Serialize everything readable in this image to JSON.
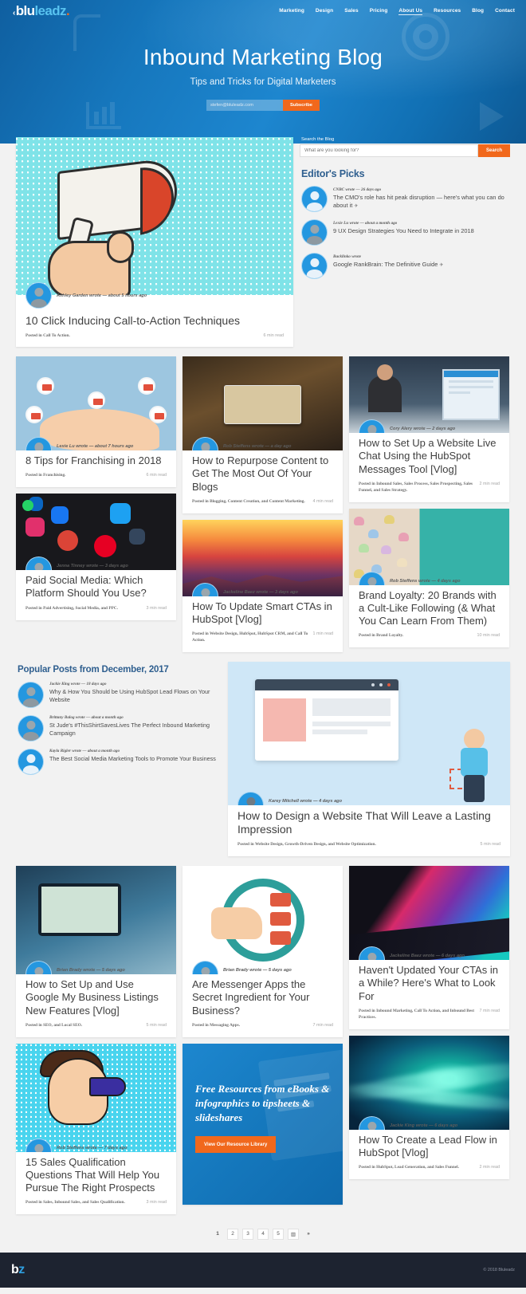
{
  "brand": {
    "mark": "‹",
    "name_a": "blu",
    "name_b": "leadz",
    "dot": "."
  },
  "nav": {
    "items": [
      "Marketing",
      "Design",
      "Sales",
      "Pricing",
      "About Us",
      "Resources",
      "Blog",
      "Contact"
    ]
  },
  "hero": {
    "title": "Inbound Marketing Blog",
    "subtitle": "Tips and Tricks for Digital Marketers",
    "email_value": "stefen@bluleadz.com",
    "email_placeholder": "stefen@bluleadz.com",
    "subscribe_label": "Subscribe"
  },
  "search": {
    "label": "Search the Blog",
    "placeholder": "What are you looking for?",
    "value": "",
    "button_label": "Search"
  },
  "editors_picks": {
    "heading": "Editor's Picks",
    "items": [
      {
        "meta": "CNBC wrote — 26 days ago",
        "title": "The CMO's role has hit peak disruption — here's what you can do about it",
        "external": true,
        "avatar": "generic"
      },
      {
        "meta": "Lexie Lu wrote — about a month ago",
        "title": "9 UX Design Strategies You Need to Integrate in 2018",
        "external": false,
        "avatar": "photo"
      },
      {
        "meta": "Backlinko wrote",
        "title": "Google RankBrain: The Definitive Guide",
        "external": true,
        "avatar": "generic"
      }
    ]
  },
  "featured": {
    "meta": "Ashley Garden wrote — about 5 hours ago",
    "title": "10 Click Inducing Call-to-Action Techniques",
    "posted_in": "Posted in Call To Action.",
    "read_time": "6 min read"
  },
  "popular": {
    "heading": "Popular Posts from December, 2017",
    "items": [
      {
        "meta": "Jackie King wrote — 18 days ago",
        "title": "Why & How You Should be Using HubSpot Lead Flows on Your Website"
      },
      {
        "meta": "Brittany Balog wrote — about a month ago",
        "title": "St Jude's #ThisShirtSavesLives The Perfect Inbound Marketing Campaign"
      },
      {
        "meta": "Kayla Rigler wrote — about a month ago",
        "title": "The Best Social Media Marketing Tools to Promote Your Business"
      }
    ]
  },
  "popular_feature": {
    "meta": "Karey Mitchell wrote — 4 days ago",
    "title": "How to Design a Website That Will Leave a Lasting Impression",
    "posted_in": "Posted in Website Design, Growth-Driven Design, and Website Optimization.",
    "read_time": "5 min read"
  },
  "cta": {
    "headline": "Free Resources from eBooks & infographics to tipsheets & slideshares",
    "button_label": "View Our Resource Library"
  },
  "posts": [
    {
      "meta": "Lexie Lu wrote — about 7 hours ago",
      "title": "8 Tips for Franchising in 2018",
      "posted_in": "Posted in Franchising.",
      "read_time": "6 min read"
    },
    {
      "meta": "Rob Steffens wrote — a day ago",
      "title": "How to Repurpose Content to Get The Most Out Of Your Blogs",
      "posted_in": "Posted in Blogging, Content Creation, and Content Marketing.",
      "read_time": "4 min read"
    },
    {
      "meta": "Cory Alery wrote — 2 days ago",
      "title": "How to Set Up a Website Live Chat Using the HubSpot Messages Tool [Vlog]",
      "posted_in": "Posted in Inbound Sales, Sales Process, Sales Prospecting, Sales Funnel, and Sales Strategy.",
      "read_time": "2 min read"
    },
    {
      "meta": "Jenna Tinney wrote — 3 days ago",
      "title": "Paid Social Media: Which Platform Should You Use?",
      "posted_in": "Posted in Paid Advertising, Social Media, and PPC.",
      "read_time": "3 min read"
    },
    {
      "meta": "Jackeline Baez wrote — 3 days ago",
      "title": "How To Update Smart CTAs in HubSpot [Vlog]",
      "posted_in": "Posted in Website Design, HubSpot, HubSpot CRM, and Call To Action.",
      "read_time": "1 min read"
    },
    {
      "meta": "Rob Steffens wrote — 4 days ago",
      "title": "Brand Loyalty: 20 Brands with a Cult-Like Following (& What You Can Learn From Them)",
      "posted_in": "Posted in Brand Loyalty.",
      "read_time": "10 min read"
    },
    {
      "meta": "Brian Brady wrote — 5 days ago",
      "title": "How to Set Up and Use Google My Business Listings New Features [Vlog]",
      "posted_in": "Posted in SEO, and Local SEO.",
      "read_time": "5 min read"
    },
    {
      "meta": "Brian Brady wrote — 5 days ago",
      "title": "Are Messenger Apps the Secret Ingredient for Your Business?",
      "posted_in": "Posted in Messaging Apps.",
      "read_time": "7 min read"
    },
    {
      "meta": "Jackeline Baez wrote — 6 days ago",
      "title": "Haven't Updated Your CTAs in a While? Here's What to Look For",
      "posted_in": "Posted in Inbound Marketing, Call To Action, and Inbound Best Practices.",
      "read_time": "7 min read"
    },
    {
      "meta": "Rob Steffens wrote — 7 days ago",
      "title": "15 Sales Qualification Questions That Will Help You Pursue The Right Prospects",
      "posted_in": "Posted in Sales, Inbound Sales, and Sales Qualification.",
      "read_time": "3 min read"
    },
    {
      "meta": "Jackie King wrote — 6 days ago",
      "title": "How To Create a Lead Flow in HubSpot [Vlog]",
      "posted_in": "Posted in HubSpot, Lead Generation, and Sales Funnel.",
      "read_time": "2 min read"
    }
  ],
  "pagination": {
    "pages": [
      "1",
      "2",
      "3",
      "4",
      "5"
    ],
    "current": "1",
    "grid_icon": "▥",
    "next_icon": "»"
  },
  "footer": {
    "logo_a": "b",
    "logo_b": "z",
    "copyright": "© 2018 Bluleadz"
  },
  "colors": {
    "accent_orange": "#f1681c",
    "brand_blue": "#1d87cf",
    "heading_blue": "#2f5f8f"
  }
}
